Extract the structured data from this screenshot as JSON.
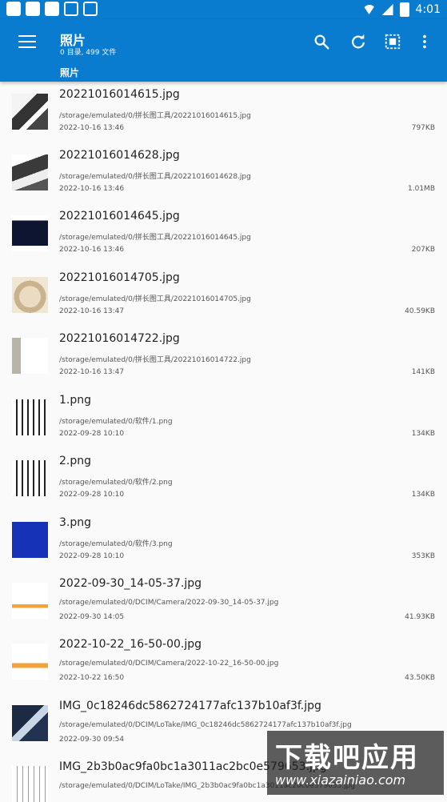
{
  "status_bar": {
    "time": "4:01"
  },
  "app_bar": {
    "title": "照片",
    "subtitle": "0 目录, 499 文件",
    "breadcrumb": "照片"
  },
  "files": [
    {
      "name": "20221016014615.jpg",
      "path": "/storage/emulated/0/拼长图工具/20221016014615.jpg",
      "date": "2022-10-16 13:46",
      "size": "797KB"
    },
    {
      "name": "20221016014628.jpg",
      "path": "/storage/emulated/0/拼长图工具/20221016014628.jpg",
      "date": "2022-10-16 13:46",
      "size": "1.01MB"
    },
    {
      "name": "20221016014645.jpg",
      "path": "/storage/emulated/0/拼长图工具/20221016014645.jpg",
      "date": "2022-10-16 13:46",
      "size": "207KB"
    },
    {
      "name": "20221016014705.jpg",
      "path": "/storage/emulated/0/拼长图工具/20221016014705.jpg",
      "date": "2022-10-16 13:47",
      "size": "40.59KB"
    },
    {
      "name": "20221016014722.jpg",
      "path": "/storage/emulated/0/拼长图工具/20221016014722.jpg",
      "date": "2022-10-16 13:47",
      "size": "141KB"
    },
    {
      "name": "1.png",
      "path": "/storage/emulated/0/软件/1.png",
      "date": "2022-09-28 10:10",
      "size": "134KB"
    },
    {
      "name": "2.png",
      "path": "/storage/emulated/0/软件/2.png",
      "date": "2022-09-28 10:10",
      "size": "134KB"
    },
    {
      "name": "3.png",
      "path": "/storage/emulated/0/软件/3.png",
      "date": "2022-09-28 10:10",
      "size": "353KB"
    },
    {
      "name": "2022-09-30_14-05-37.jpg",
      "path": "/storage/emulated/0/DCIM/Camera/2022-09-30_14-05-37.jpg",
      "date": "2022-09-30 14:05",
      "size": "41.93KB"
    },
    {
      "name": "2022-10-22_16-50-00.jpg",
      "path": "/storage/emulated/0/DCIM/Camera/2022-10-22_16-50-00.jpg",
      "date": "2022-10-22 16:50",
      "size": "43.50KB"
    },
    {
      "name": "IMG_0c18246dc5862724177afc137b10af3f.jpg",
      "path": "/storage/emulated/0/DCIM/LoTake/IMG_0c18246dc5862724177afc137b10af3f.jpg",
      "date": "2022-09-30 09:54",
      "size": ""
    },
    {
      "name": "IMG_2b3b0ac9fa0bc1a3011ac2bc0e579653.jpg",
      "path": "/storage/emulated/0/DCIM/LoTake/IMG_2b3b0ac9fa0bc1a3011ac2bc0e579653.jpg",
      "date": "",
      "size": ""
    }
  ],
  "watermark": {
    "logo": "下载吧应用",
    "url": "www.xiazainiao.com"
  },
  "colors": {
    "primary": "#0a7ccf",
    "background": "#fafafa",
    "text": "#222222",
    "secondary_text": "#555555"
  },
  "icons": {
    "menu": "menu-icon",
    "search": "search-icon",
    "refresh": "refresh-icon",
    "select": "select-all-icon",
    "more": "more-vert-icon"
  }
}
